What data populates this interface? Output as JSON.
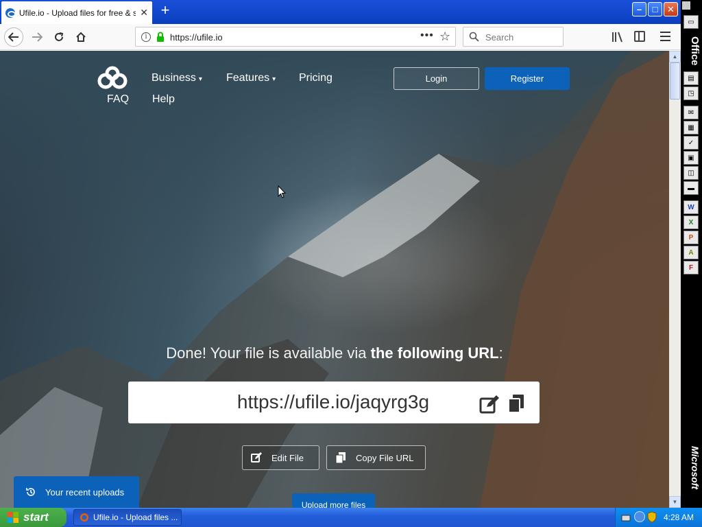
{
  "browser": {
    "tab_title": "Ufile.io - Upload files for free & sh",
    "new_tab_symbol": "+",
    "window_controls": {
      "minimize": "–",
      "maximize": "□",
      "close": "✕"
    },
    "url": "https://ufile.io",
    "search_placeholder": "Search",
    "url_menu_dots": "•••",
    "icons": [
      "back-arrow-icon",
      "forward-arrow-icon",
      "reload-icon",
      "home-icon",
      "info-icon",
      "lock-icon",
      "star-icon",
      "search-icon",
      "library-icon",
      "sidebar-icon",
      "hamburger-menu-icon"
    ]
  },
  "site": {
    "nav": {
      "business": "Business",
      "features": "Features",
      "pricing": "Pricing",
      "faq": "FAQ",
      "help": "Help",
      "caret": "⌄"
    },
    "login": "Login",
    "register": "Register",
    "done_prefix": "Done! Your file is available via ",
    "done_bold": "the following URL",
    "done_suffix": ":",
    "file_url": "https://ufile.io/jaqyrg3g",
    "edit_file": "Edit File",
    "copy_url": "Copy File URL",
    "recent_uploads": "Your recent uploads",
    "upload_more": "Upload more files",
    "colors": {
      "primary": "#0c62b9",
      "text": "#ffffff"
    }
  },
  "office_bar": {
    "label": "Office",
    "vendor": "Microsoft",
    "tiles": [
      "folder-icon",
      "binder-icon",
      "new-doc-icon",
      "mail-icon",
      "calendar-icon",
      "task-icon",
      "contact-icon",
      "journal-icon",
      "note-icon",
      "W",
      "X",
      "P",
      "A",
      "F"
    ]
  },
  "taskbar": {
    "start": "start",
    "task_item": "Ufile.io - Upload files ...",
    "clock": "4:28 AM"
  }
}
